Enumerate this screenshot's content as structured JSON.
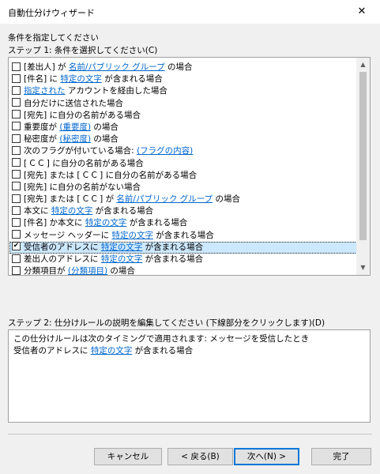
{
  "window": {
    "title": "自動仕分けウィザード",
    "close_glyph": "✕"
  },
  "instruction": "条件を指定してください",
  "step1_label": "ステップ 1: 条件を選択してください(C)",
  "conditions": [
    {
      "checked": false,
      "parts": [
        {
          "t": "[差出人] が "
        },
        {
          "t": "名前/パブリック グループ",
          "link": true
        },
        {
          "t": " の場合"
        }
      ]
    },
    {
      "checked": false,
      "parts": [
        {
          "t": "[件名] に "
        },
        {
          "t": "特定の文字",
          "link": true
        },
        {
          "t": " が含まれる場合"
        }
      ]
    },
    {
      "checked": false,
      "parts": [
        {
          "t": "指定された",
          "link": true
        },
        {
          "t": " アカウントを経由した場合"
        }
      ]
    },
    {
      "checked": false,
      "parts": [
        {
          "t": "自分だけに送信された場合"
        }
      ]
    },
    {
      "checked": false,
      "parts": [
        {
          "t": "[宛先] に自分の名前がある場合"
        }
      ]
    },
    {
      "checked": false,
      "parts": [
        {
          "t": "重要度が "
        },
        {
          "t": "(重要度)",
          "link": true
        },
        {
          "t": " の場合"
        }
      ]
    },
    {
      "checked": false,
      "parts": [
        {
          "t": "秘密度が "
        },
        {
          "t": "(秘密度)",
          "link": true
        },
        {
          "t": " の場合"
        }
      ]
    },
    {
      "checked": false,
      "parts": [
        {
          "t": "次のフラグが付いている場合: "
        },
        {
          "t": "(フラグの内容)",
          "link": true
        }
      ]
    },
    {
      "checked": false,
      "parts": [
        {
          "t": "[ C C ] に自分の名前がある場合"
        }
      ]
    },
    {
      "checked": false,
      "parts": [
        {
          "t": "[宛先] または [ C C ] に自分の名前がある場合"
        }
      ]
    },
    {
      "checked": false,
      "parts": [
        {
          "t": "[宛先] に自分の名前がない場合"
        }
      ]
    },
    {
      "checked": false,
      "parts": [
        {
          "t": "[宛先] または [ C C ] が "
        },
        {
          "t": "名前/パブリック グループ",
          "link": true
        },
        {
          "t": " の場合"
        }
      ]
    },
    {
      "checked": false,
      "parts": [
        {
          "t": "本文に "
        },
        {
          "t": "特定の文字",
          "link": true
        },
        {
          "t": " が含まれる場合"
        }
      ]
    },
    {
      "checked": false,
      "parts": [
        {
          "t": "[件名] か本文に "
        },
        {
          "t": "特定の文字",
          "link": true
        },
        {
          "t": " が含まれる場合"
        }
      ]
    },
    {
      "checked": false,
      "parts": [
        {
          "t": "メッセージ ヘッダーに "
        },
        {
          "t": "特定の文字",
          "link": true
        },
        {
          "t": " が含まれる場合"
        }
      ]
    },
    {
      "checked": true,
      "selected": true,
      "parts": [
        {
          "t": "受信者のアドレスに "
        },
        {
          "t": "特定の文字",
          "link": true
        },
        {
          "t": " が含まれる場合"
        }
      ]
    },
    {
      "checked": false,
      "parts": [
        {
          "t": "差出人のアドレスに "
        },
        {
          "t": "特定の文字",
          "link": true
        },
        {
          "t": " が含まれる場合"
        }
      ]
    },
    {
      "checked": false,
      "parts": [
        {
          "t": "分類項目が "
        },
        {
          "t": "(分類項目)",
          "link": true
        },
        {
          "t": " の場合"
        }
      ]
    }
  ],
  "step2_label": "ステップ 2: 仕分けルールの説明を編集してください (下線部分をクリックします)(D)",
  "description": [
    [
      {
        "t": "この仕分けルールは次のタイミングで適用されます: メッセージを受信したとき"
      }
    ],
    [
      {
        "t": "受信者のアドレスに "
      },
      {
        "t": "特定の文字",
        "link": true
      },
      {
        "t": " が含まれる場合"
      }
    ]
  ],
  "buttons": {
    "cancel": "キャンセル",
    "back": "< 戻る(B)",
    "next": "次へ(N) >",
    "finish": "完了"
  },
  "colors": {
    "link": "#0066cc",
    "selection": "#cce8ff",
    "default_button_border": "#0078d7"
  }
}
